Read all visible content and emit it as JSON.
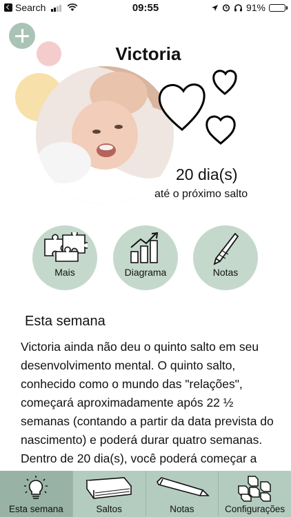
{
  "status_bar": {
    "back_app": "Search",
    "time": "09:55",
    "battery": "91%",
    "battery_level": 0.91
  },
  "header": {
    "baby_name": "Victoria"
  },
  "countdown": {
    "value": "20 dia(s)",
    "caption": "até o próximo salto"
  },
  "actions": [
    {
      "label": "Mais",
      "icon": "puzzle-icon"
    },
    {
      "label": "Diagrama",
      "icon": "chart-icon"
    },
    {
      "label": "Notas",
      "icon": "pencil-icon"
    }
  ],
  "week": {
    "title": "Esta semana",
    "body": "Victoria ainda não deu o quinto salto em seu desenvolvimento mental. O quinto salto, conhecido como o mundo das \"relações\", começará aproximadamente após 22 ½ semanas (contando a partir da data prevista do nascimento) e poderá durar quatro semanas. Dentro de 20 dia(s), você poderá começar a notar os sinais do"
  },
  "tabs": [
    {
      "label": "Esta semana",
      "icon": "lightbulb-icon",
      "active": true
    },
    {
      "label": "Saltos",
      "icon": "book-icon",
      "active": false
    },
    {
      "label": "Notas",
      "icon": "pencil-icon",
      "active": false
    },
    {
      "label": "Configurações",
      "icon": "blocks-icon",
      "active": false
    }
  ],
  "colors": {
    "accent_green": "#c5d8cc",
    "tabbar": "#b3ccbf",
    "tab_active": "#98b3a6",
    "pink": "#f4cccb",
    "yellow": "#f8e0aa"
  }
}
